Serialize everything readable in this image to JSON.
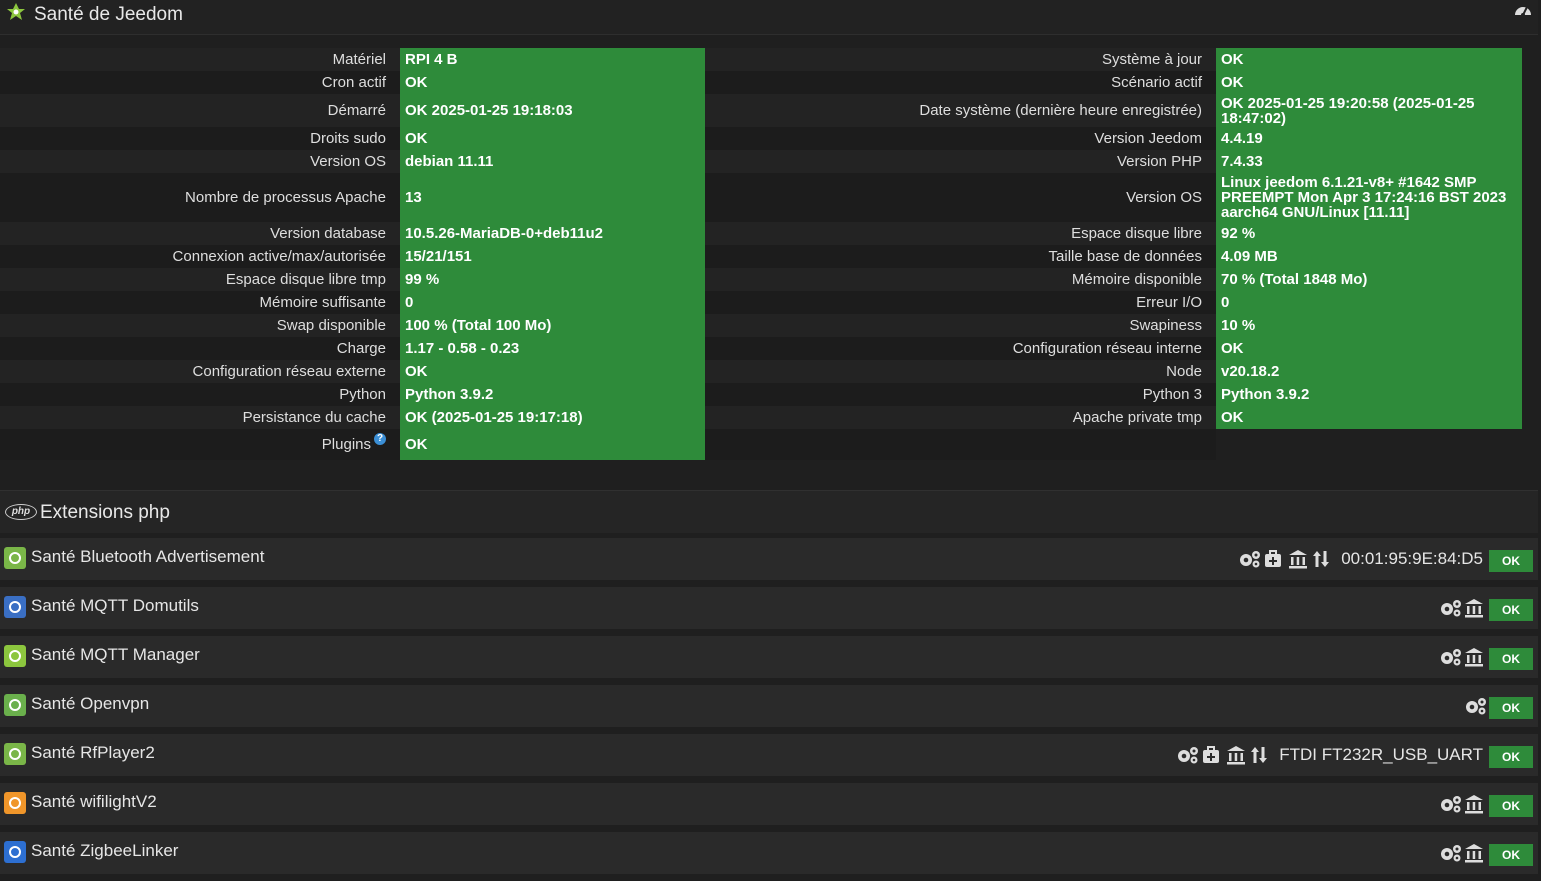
{
  "header": {
    "title": "Santé de Jeedom"
  },
  "health_rows": [
    {
      "l1": "Matériel",
      "v1": "RPI 4 B",
      "l2": "Système à jour",
      "v2": "OK"
    },
    {
      "l1": "Cron actif",
      "v1": "OK",
      "l2": "Scénario actif",
      "v2": "OK"
    },
    {
      "l1": "Démarré",
      "v1": "OK 2025-01-25 19:18:03",
      "l2": "Date système (dernière heure enregistrée)",
      "v2": "OK 2025-01-25 19:20:58 (2025-01-25 18:47:02)"
    },
    {
      "l1": "Droits sudo",
      "v1": "OK",
      "l2": "Version Jeedom",
      "v2": "4.4.19"
    },
    {
      "l1": "Version OS",
      "v1": "debian 11.11",
      "l2": "Version PHP",
      "v2": "7.4.33"
    },
    {
      "l1": "Nombre de processus Apache",
      "v1": "13",
      "l2": "Version OS",
      "v2": "Linux jeedom 6.1.21-v8+ #1642 SMP PREEMPT Mon Apr 3 17:24:16 BST 2023 aarch64 GNU/Linux [11.11]"
    },
    {
      "l1": "Version database",
      "v1": "10.5.26-MariaDB-0+deb11u2",
      "l2": "Espace disque libre",
      "v2": "92 %"
    },
    {
      "l1": "Connexion active/max/autorisée",
      "v1": "15/21/151",
      "l2": "Taille base de données",
      "v2": "4.09 MB"
    },
    {
      "l1": "Espace disque libre tmp",
      "v1": "99 %",
      "l2": "Mémoire disponible",
      "v2": "70 % (Total 1848 Mo)"
    },
    {
      "l1": "Mémoire suffisante",
      "v1": "0",
      "l2": "Erreur I/O",
      "v2": "0"
    },
    {
      "l1": "Swap disponible",
      "v1": "100 % (Total 100 Mo)",
      "l2": "Swapiness",
      "v2": "10 %"
    },
    {
      "l1": "Charge",
      "v1": "1.17 - 0.58 - 0.23",
      "l2": "Configuration réseau interne",
      "v2": "OK"
    },
    {
      "l1": "Configuration réseau externe",
      "v1": "OK",
      "l2": "Node",
      "v2": "v20.18.2"
    },
    {
      "l1": "Python",
      "v1": "Python 3.9.2",
      "l2": "Python 3",
      "v2": "Python 3.9.2"
    },
    {
      "l1": "Persistance du cache",
      "v1": "OK (2025-01-25 19:17:18)",
      "l2": "Apache private tmp",
      "v2": "OK"
    },
    {
      "l1": "Plugins",
      "v1": "OK",
      "l2": "",
      "v2": ""
    }
  ],
  "plugins_help_icon": "?",
  "php_section": {
    "logo_text": "php",
    "title": "Extensions php"
  },
  "plugins": [
    {
      "name": "Santé Bluetooth Advertisement",
      "info": "00:01:95:9E:84:D5",
      "status": "OK",
      "icons": [
        "cogs-icon",
        "medkit-icon",
        "bank-icon",
        "arrows-updown-icon"
      ],
      "color": "#7ab648"
    },
    {
      "name": "Santé MQTT Domutils",
      "info": "",
      "status": "OK",
      "icons": [
        "cogs-icon",
        "bank-icon"
      ],
      "color": "#3a6fc4"
    },
    {
      "name": "Santé MQTT Manager",
      "info": "",
      "status": "OK",
      "icons": [
        "cogs-icon",
        "bank-icon"
      ],
      "color": "#8cc63e"
    },
    {
      "name": "Santé Openvpn",
      "info": "",
      "status": "OK",
      "icons": [
        "cogs-icon"
      ],
      "color": "#6ab04c"
    },
    {
      "name": "Santé RfPlayer2",
      "info": "FTDI FT232R_USB_UART",
      "status": "OK",
      "icons": [
        "cogs-icon",
        "medkit-icon",
        "bank-icon",
        "arrows-updown-icon"
      ],
      "color": "#7ab648"
    },
    {
      "name": "Santé wifilightV2",
      "info": "",
      "status": "OK",
      "icons": [
        "cogs-icon",
        "bank-icon"
      ],
      "color": "#f0962a"
    },
    {
      "name": "Santé ZigbeeLinker",
      "info": "",
      "status": "OK",
      "icons": [
        "cogs-icon",
        "bank-icon"
      ],
      "color": "#2d6fd1"
    }
  ]
}
